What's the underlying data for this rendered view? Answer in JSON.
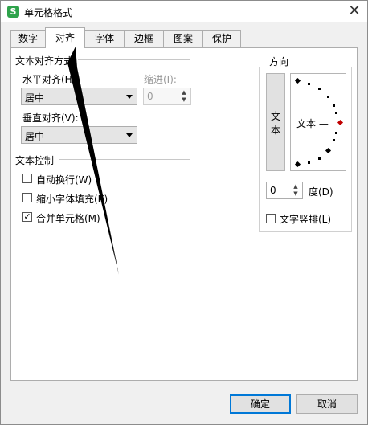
{
  "window": {
    "title": "单元格格式",
    "app_icon": "S",
    "close_glyph": "✕"
  },
  "tabs": [
    {
      "label": "数字",
      "active": false
    },
    {
      "label": "对齐",
      "active": true
    },
    {
      "label": "字体",
      "active": false
    },
    {
      "label": "边框",
      "active": false
    },
    {
      "label": "图案",
      "active": false
    },
    {
      "label": "保护",
      "active": false
    }
  ],
  "alignment": {
    "group_label": "文本对齐方式",
    "horizontal_label": "水平对齐(H):",
    "horizontal_value": "居中",
    "indent_label": "缩进(I):",
    "indent_value": "0",
    "vertical_label": "垂直对齐(V):",
    "vertical_value": "居中"
  },
  "text_control": {
    "group_label": "文本控制",
    "wrap_label": "自动换行(W)",
    "wrap_checked": false,
    "shrink_label": "缩小字体填充(K)",
    "shrink_checked": false,
    "merge_label": "合并单元格(M)",
    "merge_checked": true
  },
  "orientation": {
    "group_label": "方向",
    "vertical_char_1": "文",
    "vertical_char_2": "本",
    "dial_text": "文本 —",
    "degrees_value": "0",
    "degrees_label": "度(D)",
    "stack_label": "文字竖排(L)",
    "stack_checked": false
  },
  "buttons": {
    "ok": "确定",
    "cancel": "取消"
  },
  "colors": {
    "accent": "#0078d7",
    "app_icon_bg": "#2ea34b",
    "dial_center": "#c00000"
  }
}
